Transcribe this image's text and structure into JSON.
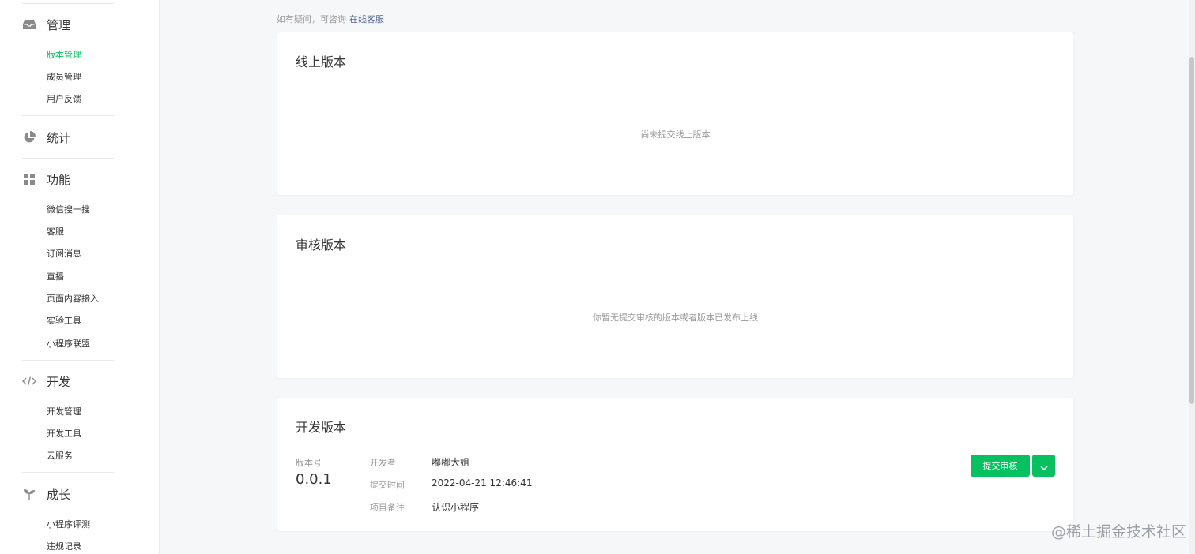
{
  "sidebar": {
    "groups": [
      {
        "label": "管理",
        "icon": "inbox-icon",
        "items": [
          "版本管理",
          "成员管理",
          "用户反馈"
        ]
      },
      {
        "label": "统计",
        "icon": "pie-chart-icon",
        "items": []
      },
      {
        "label": "功能",
        "icon": "grid-icon",
        "items": [
          "微信搜一搜",
          "客服",
          "订阅消息",
          "直播",
          "页面内容接入",
          "实验工具",
          "小程序联盟"
        ]
      },
      {
        "label": "开发",
        "icon": "code-icon",
        "items": [
          "开发管理",
          "开发工具",
          "云服务"
        ]
      },
      {
        "label": "成长",
        "icon": "sprout-icon",
        "items": [
          "小程序评测",
          "违规记录"
        ]
      }
    ],
    "active_item": "版本管理",
    "accent_color": "#07c160"
  },
  "tip": {
    "text": "如有疑问，可咨询",
    "link": "在线客服"
  },
  "online_version": {
    "title": "线上版本",
    "empty_text": "尚未提交线上版本"
  },
  "review_version": {
    "title": "审核版本",
    "empty_text": "你暂无提交审核的版本或者版本已发布上线"
  },
  "dev_version": {
    "title": "开发版本",
    "version_label": "版本号",
    "version_value": "0.0.1",
    "developer_label": "开发者",
    "developer_value": "嘟嘟大姐",
    "submit_time_label": "提交时间",
    "submit_time_value": "2022-04-21 12:46:41",
    "note_label": "项目备注",
    "note_value": "认识小程序",
    "submit_button": "提交审核",
    "dropdown_icon": "chevron-down-icon"
  },
  "watermark": "@稀土掘金技术社区"
}
